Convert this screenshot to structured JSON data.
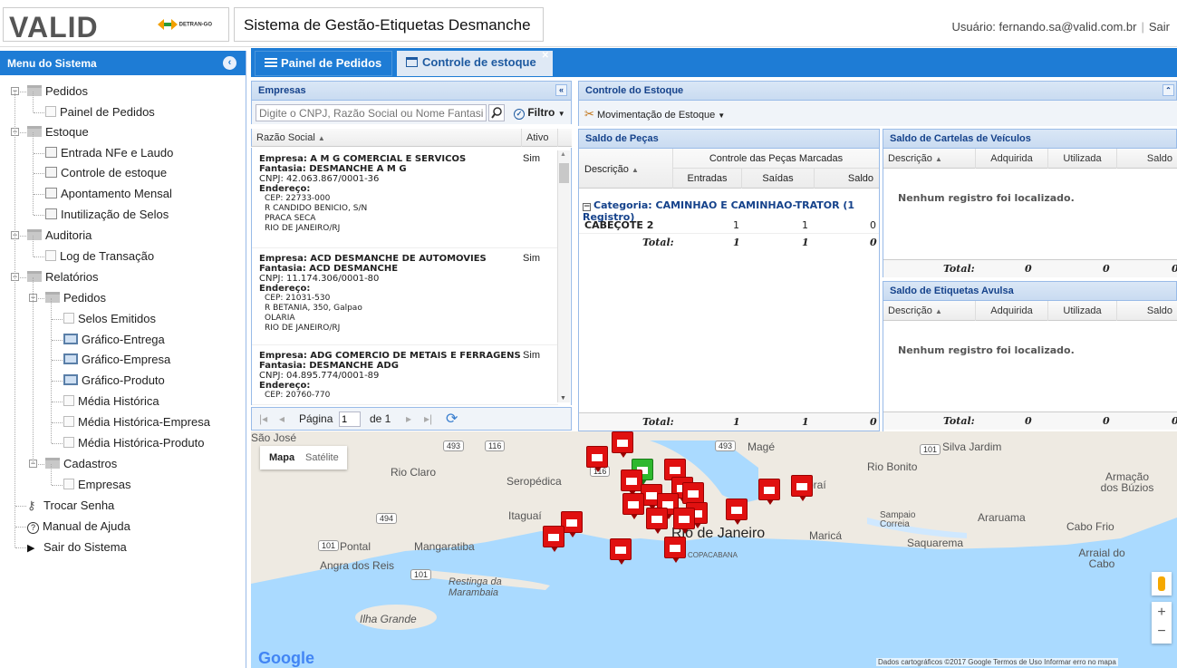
{
  "header": {
    "logo_text": "VALID",
    "detran_text": "DETRAN-GO",
    "app_title": "Sistema de Gestão-Etiquetas Desmanche",
    "user_label": "Usuário: fernando.sa@valid.com.br",
    "logout_label": "Sair"
  },
  "sidebar": {
    "title": "Menu do Sistema",
    "items": [
      {
        "label": "Pedidos"
      },
      {
        "label": "Painel de Pedidos"
      },
      {
        "label": "Estoque"
      },
      {
        "label": "Entrada NFe e Laudo"
      },
      {
        "label": "Controle de estoque"
      },
      {
        "label": "Apontamento Mensal"
      },
      {
        "label": "Inutilização de Selos"
      },
      {
        "label": "Auditoria"
      },
      {
        "label": "Log de Transação"
      },
      {
        "label": "Relatórios"
      },
      {
        "label": "Pedidos"
      },
      {
        "label": "Selos Emitidos"
      },
      {
        "label": "Gráfico-Entrega"
      },
      {
        "label": "Gráfico-Empresa"
      },
      {
        "label": "Gráfico-Produto"
      },
      {
        "label": "Média Histórica"
      },
      {
        "label": "Média Histórica-Empresa"
      },
      {
        "label": "Média Histórica-Produto"
      },
      {
        "label": "Cadastros"
      },
      {
        "label": "Empresas"
      },
      {
        "label": "Trocar Senha"
      },
      {
        "label": "Manual de Ajuda"
      },
      {
        "label": "Sair do Sistema"
      }
    ]
  },
  "tabs": [
    {
      "label": "Painel de Pedidos"
    },
    {
      "label": "Controle de estoque"
    }
  ],
  "empresas": {
    "title": "Empresas",
    "search_placeholder": "Digite o CNPJ, Razão Social ou Nome Fantasia...",
    "filter_label": "Filtro",
    "col_razao": "Razão Social",
    "col_ativo": "Ativo",
    "rows": [
      {
        "empresa": "Empresa: A M G COMERCIAL E SERVICOS",
        "fantasia": "Fantasia: DESMANCHE A M G",
        "cnpj": "CNPJ: 42.063.867/0001-36",
        "endereco_label": "Endereço:",
        "cep": "CEP: 22733-000",
        "rua": "R CANDIDO BENICIO, S/N",
        "bairro": "PRACA SECA",
        "cidade": "RIO DE JANEIRO/RJ",
        "ativo": "Sim"
      },
      {
        "empresa": "Empresa: ACD DESMANCHE DE AUTOMOVIES",
        "fantasia": "Fantasia: ACD DESMANCHE",
        "cnpj": "CNPJ: 11.174.306/0001-80",
        "endereco_label": "Endereço:",
        "cep": "CEP: 21031-530",
        "rua": "R BETANIA, 350, Galpao",
        "bairro": "OLARIA",
        "cidade": "RIO DE JANEIRO/RJ",
        "ativo": "Sim"
      },
      {
        "empresa": "Empresa: ADG COMERCIO DE METAIS E FERRAGENS",
        "fantasia": "Fantasia: DESMANCHE ADG",
        "cnpj": "CNPJ: 04.895.774/0001-89",
        "endereco_label": "Endereço:",
        "cep": "CEP: 20760-770",
        "ativo": "Sim"
      }
    ],
    "pager": {
      "page_label": "Página",
      "page_value": "1",
      "of_label": "de 1"
    }
  },
  "controle": {
    "title": "Controle do Estoque",
    "toolbar_label": "Movimentação de Estoque",
    "saldo_pecas": {
      "title": "Saldo de Peças",
      "col_descricao": "Descrição",
      "group_header": "Controle das Peças Marcadas",
      "col_entradas": "Entradas",
      "col_saidas": "Saídas",
      "col_saldo": "Saldo",
      "category": "Categoria: CAMINHAO E CAMINHAO-TRATOR (1 Registro)",
      "row": {
        "descricao": "CABEÇOTE 2",
        "entradas": "1",
        "saidas": "1",
        "saldo": "0"
      },
      "subtotal": {
        "label": "Total:",
        "entradas": "1",
        "saidas": "1",
        "saldo": "0"
      },
      "total": {
        "label": "Total:",
        "entradas": "1",
        "saidas": "1",
        "saldo": "0"
      }
    },
    "saldo_cartelas": {
      "title": "Saldo de Cartelas de Veículos",
      "col_descricao": "Descrição",
      "col_adquirida": "Adquirida",
      "col_utilizada": "Utilizada",
      "col_saldo": "Saldo",
      "empty": "Nenhum registro foi localizado.",
      "total": {
        "label": "Total:",
        "adquirida": "0",
        "utilizada": "0",
        "saldo": "0"
      }
    },
    "saldo_etiquetas": {
      "title": "Saldo de Etiquetas Avulsa",
      "col_descricao": "Descrição",
      "col_adquirida": "Adquirida",
      "col_utilizada": "Utilizada",
      "col_saldo": "Saldo",
      "empty": "Nenhum registro foi localizado.",
      "total": {
        "label": "Total:",
        "adquirida": "0",
        "utilizada": "0",
        "saldo": "0"
      }
    }
  },
  "map": {
    "type_map": "Mapa",
    "type_sat": "Satélite",
    "labels": [
      "Rio Claro",
      "Seropédica",
      "Itaguaí",
      "Rio de Janeiro",
      "Maricá",
      "Magé",
      "Silva Jardim",
      "Rio Bonito",
      "Armação dos Búzios",
      "Cabo Frio",
      "Araruama",
      "Saquarema",
      "Sampaio Correia",
      "Arraial do Cabo",
      "Pontal",
      "Mangaratiba",
      "Angra dos Reis",
      "Restinga da Marambaia",
      "Ilha Grande",
      "COPACABANA",
      "São José",
      "oraí"
    ],
    "roads": [
      "116",
      "493",
      "493",
      "101",
      "494",
      "101",
      "101",
      "116"
    ],
    "google": "Google",
    "footer": "Dados cartográficos ©2017 Google   Termos de Uso   Informar erro no mapa"
  },
  "colors": {
    "accent": "#1e7cd5",
    "panel_border": "#99bbe8",
    "pin": "#e01010"
  }
}
